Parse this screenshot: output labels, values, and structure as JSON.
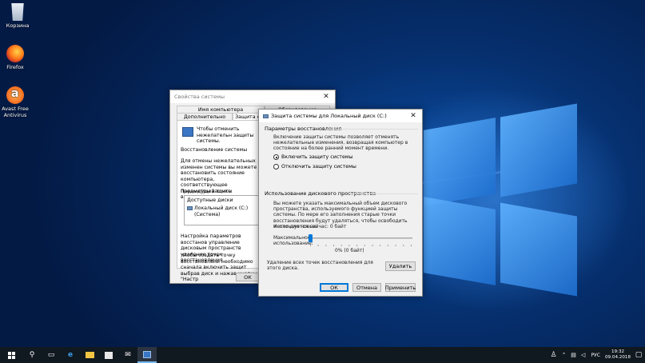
{
  "desktop": {
    "icons": [
      {
        "label": "Корзина"
      },
      {
        "label": "Firefox"
      },
      {
        "label": "Avast Free Antivirus"
      }
    ]
  },
  "system_properties": {
    "title": "Свойства системы",
    "tabs_top": [
      "Имя компьютера",
      "Оборудование"
    ],
    "tabs_bottom": [
      "Дополнительно",
      "Защита системы"
    ],
    "intro": "Чтобы отменить нежелательн защиты системы.",
    "restore_heading": "Восстановление системы",
    "restore_text": "Для отмены нежелательных изменен системы вы можете восстановить состояние компьютера, соответствующее предыдущей точке восстановления.",
    "params_heading": "Параметры защиты",
    "list_header": "Доступные диски",
    "list_item": "Локальный диск (C:) (Система)",
    "config_text": "Настройка параметров восстанов управление дисковым пространств удаление точек восстановления",
    "create_text": "Чтобы создать точку восстановлени необходимо сначала включить защит выбрав диск и нажав кнопку \"Настр",
    "ok_label": "ОК"
  },
  "protection_dialog": {
    "title": "Защита системы для Локальный диск (C:)",
    "close_glyph": "✕",
    "restore_group": "Параметры восстановления",
    "restore_desc": "Включение защиты системы позволяет отменять нежелательные изменения, возвращая компьютер в состояние на более ранний момент времени.",
    "radio_on": "Включить защиту системы",
    "radio_off": "Отключить защиту системы",
    "usage_group": "Использование дискового пространства",
    "usage_desc": "Вы можете указать максимальный объем дискового пространства, используемого функцией защиты системы. По мере его заполнения старые точки восстановления будут удаляться, чтобы освободить место для новых.",
    "current_usage": "Используется сейчас:   0 байт",
    "max_usage_label": "Максимальное использование:",
    "slider_value_text": "0% (0 байт)",
    "slider_fraction": 0.0,
    "delete_desc": "Удаление всех точек восстановления для этого диска.",
    "delete_button": "Удалить",
    "ok_button": "ОК",
    "cancel_button": "Отмена",
    "apply_button": "Применить"
  },
  "taskbar": {
    "language": "РУС",
    "time": "19:32",
    "date": "09.04.2018"
  }
}
